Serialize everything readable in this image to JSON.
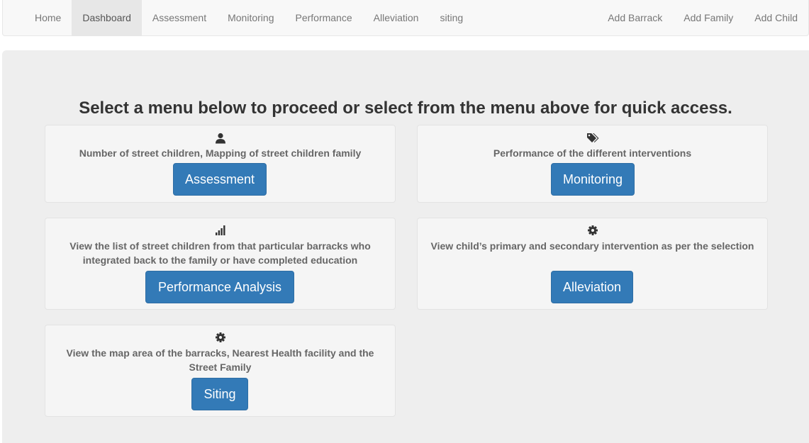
{
  "navbar": {
    "left_items": [
      {
        "label": "Home",
        "active": false
      },
      {
        "label": "Dashboard",
        "active": true
      },
      {
        "label": "Assessment",
        "active": false
      },
      {
        "label": "Monitoring",
        "active": false
      },
      {
        "label": "Performance",
        "active": false
      },
      {
        "label": "Alleviation",
        "active": false
      },
      {
        "label": "siting",
        "active": false
      }
    ],
    "right_items": [
      {
        "label": "Add Barrack"
      },
      {
        "label": "Add Family"
      },
      {
        "label": "Add Child"
      }
    ]
  },
  "main": {
    "lead": "Select a menu below to proceed or select from the menu above for quick access.",
    "cards": [
      {
        "icon": "user-icon",
        "description": "Number of street children, Mapping of street children family",
        "button": "Assessment"
      },
      {
        "icon": "tags-icon",
        "description": "Performance of the different interventions",
        "button": "Monitoring"
      },
      {
        "icon": "signal-icon",
        "description": "View the list of street children from that particular barracks who integrated back to the family or have completed education",
        "button": "Performance Analysis"
      },
      {
        "icon": "cog-icon",
        "description": "View child’s primary and secondary intervention as per the selection",
        "button": "Alleviation"
      },
      {
        "icon": "cog-icon",
        "description": "View the map area of the barracks, Nearest Health facility and the Street Family",
        "button": "Siting"
      }
    ]
  },
  "colors": {
    "primary_button": "#337ab7",
    "jumbotron_bg": "#eeeeee",
    "navbar_bg": "#f8f8f8",
    "nav_active_bg": "#e7e7e7"
  }
}
